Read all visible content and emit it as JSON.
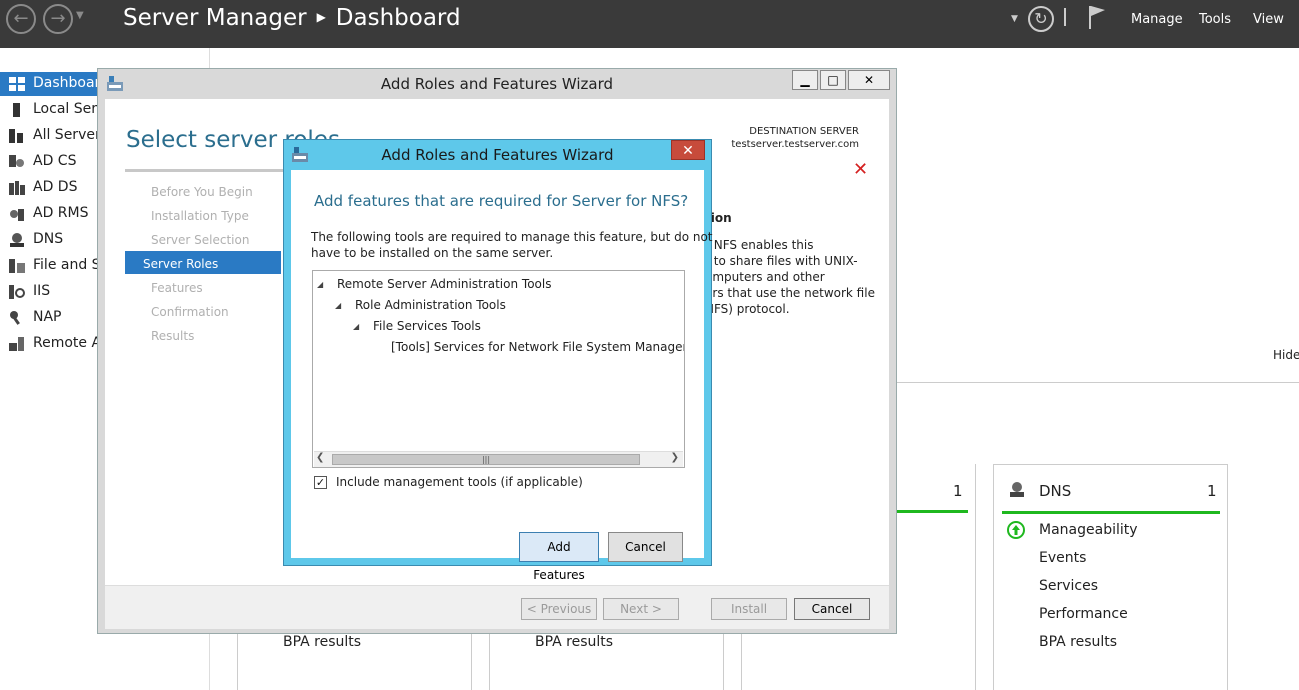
{
  "window": {
    "title_app": "Server Manager",
    "title_page": "Dashboard",
    "menu": [
      "Manage",
      "Tools",
      "View"
    ]
  },
  "sidebar": {
    "items": [
      {
        "label": "Dashboard",
        "icon": "dashboard-icon",
        "active": true
      },
      {
        "label": "Local Serve",
        "icon": "server-icon"
      },
      {
        "label": "All Servers",
        "icon": "servers-icon"
      },
      {
        "label": "AD CS",
        "icon": "certificate-icon"
      },
      {
        "label": "AD DS",
        "icon": "directory-icon"
      },
      {
        "label": "AD RMS",
        "icon": "rights-icon"
      },
      {
        "label": "DNS",
        "icon": "dns-icon"
      },
      {
        "label": "File and St",
        "icon": "file-storage-icon"
      },
      {
        "label": "IIS",
        "icon": "iis-icon"
      },
      {
        "label": "NAP",
        "icon": "nap-icon"
      },
      {
        "label": "Remote Ac",
        "icon": "remote-access-icon"
      }
    ]
  },
  "background": {
    "hide_label": "Hide",
    "tile_mid_count": "1",
    "dns_tile": {
      "title": "DNS",
      "count": "1",
      "rows": [
        "Manageability",
        "Events",
        "Services",
        "Performance",
        "BPA results"
      ]
    },
    "bpa_left": "BPA results",
    "bpa_mid": "BPA results"
  },
  "wizard": {
    "title": "Add Roles and Features Wizard",
    "page_title": "Select server roles",
    "destination_label": "DESTINATION SERVER",
    "destination_server": "testserver.testserver.com",
    "steps": [
      "Before You Begin",
      "Installation Type",
      "Server Selection",
      "Server Roles",
      "Features",
      "Confirmation",
      "Results"
    ],
    "active_step": "Server Roles",
    "description_heading": "tion",
    "description_lines": [
      "r NFS enables this",
      "r to share files with UNIX-",
      "omputers and other",
      "ers that use the network file",
      "NFS) protocol."
    ],
    "buttons": {
      "previous": "< Previous",
      "next": "Next >",
      "install": "Install",
      "cancel": "Cancel"
    }
  },
  "dialog": {
    "title": "Add Roles and Features Wizard",
    "heading": "Add features that are required for Server for NFS?",
    "body_line1": "The following tools are required to manage this feature, but do not",
    "body_line2": "have to be installed on the same server.",
    "tree": [
      "Remote Server Administration Tools",
      "Role Administration Tools",
      "File Services Tools",
      "[Tools] Services for Network File System Management T"
    ],
    "checkbox_label": "Include management tools (if applicable)",
    "checkbox_checked": true,
    "add_button": "Add Features",
    "cancel_button": "Cancel"
  },
  "colors": {
    "titlebar": "#3a3a3a",
    "accent": "#2a7ac4",
    "dialog_frame": "#5ec8ea",
    "close_red": "#c74b3b",
    "status_green": "#1fb81f",
    "error_red": "#d42020"
  }
}
